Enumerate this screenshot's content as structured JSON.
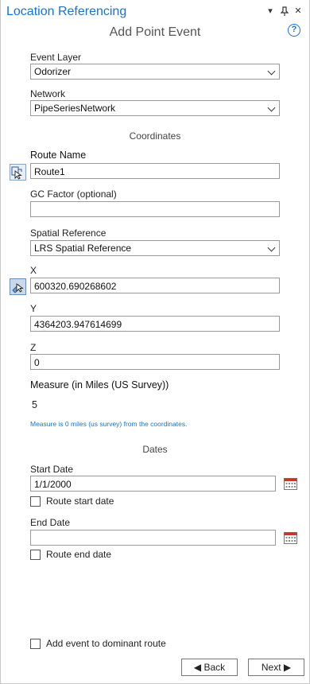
{
  "window": {
    "title": "Location Referencing",
    "pin_glyph": "↕",
    "close_glyph": "✕",
    "menu_glyph": "▾"
  },
  "form": {
    "title": "Add Point Event",
    "help_glyph": "?",
    "event_layer": {
      "label": "Event Layer",
      "value": "Odorizer"
    },
    "network": {
      "label": "Network",
      "value": "PipeSeriesNetwork"
    },
    "coordinates_header": "Coordinates",
    "route_name": {
      "label": "Route Name",
      "value": "Route1"
    },
    "gc_factor": {
      "label": "GC Factor (optional)",
      "value": ""
    },
    "spatial_reference": {
      "label": "Spatial Reference",
      "value": "LRS Spatial Reference"
    },
    "x": {
      "label": "X",
      "value": "600320.690268602"
    },
    "y": {
      "label": "Y",
      "value": "4364203.947614699"
    },
    "z": {
      "label": "Z",
      "value": "0"
    },
    "measure": {
      "label": "Measure (in Miles (US Survey))",
      "value": "5",
      "note": "Measure is 0 miles (us survey) from the coordinates."
    },
    "dates_header": "Dates",
    "start_date": {
      "label": "Start Date",
      "value": "1/1/2000",
      "checkbox_label": "Route start date"
    },
    "end_date": {
      "label": "End Date",
      "value": "",
      "checkbox_label": "Route end date"
    },
    "dominant_route_label": "Add event to dominant route",
    "back_label": "◀ Back",
    "next_label": "Next ▶"
  },
  "icons": {
    "route_picker": "select-route-tool-icon",
    "xy_picker": "pick-coordinates-tool-icon",
    "calendar": "calendar-icon"
  },
  "colors": {
    "accent": "#1a73c8",
    "note": "#1a73c8"
  }
}
